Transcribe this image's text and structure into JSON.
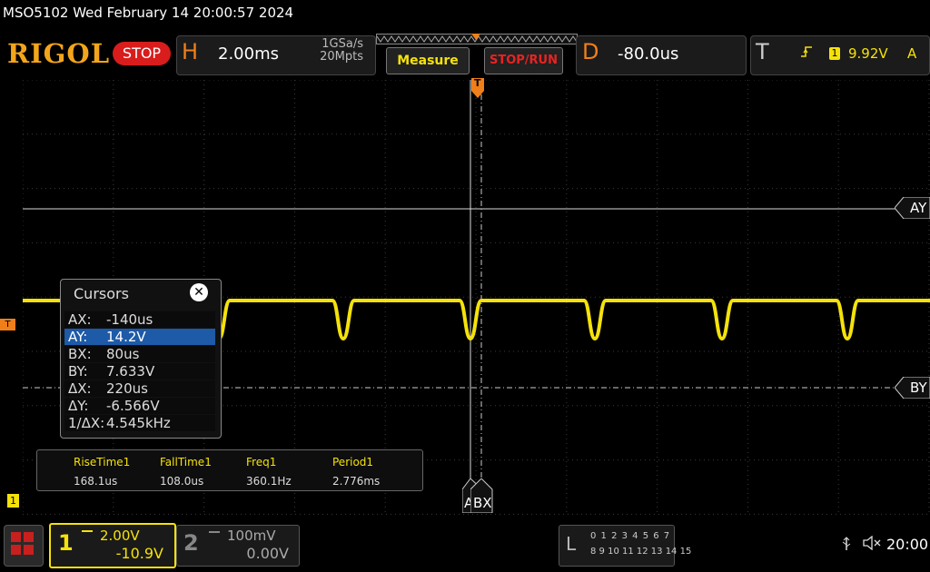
{
  "header": {
    "title_bar": "MSO5102  Wed February 14 20:00:57 2024",
    "logo": "RIGOL",
    "run_state": "STOP"
  },
  "horizontal": {
    "letter": "H",
    "timebase": "2.00ms",
    "sample_rate": "1GSa/s",
    "memory_depth": "20Mpts"
  },
  "buttons": {
    "measure": "Measure",
    "stop_run": "STOP/RUN"
  },
  "delay": {
    "letter": "D",
    "value": "-80.0us"
  },
  "trigger": {
    "letter": "T",
    "edge_icon": "rising-edge-icon",
    "source": "1",
    "level": "9.92V",
    "mode": "A"
  },
  "markers": {
    "trigger_top": "T",
    "trigger_level": "T",
    "ch1": "1",
    "ay": "AY",
    "by": "BY",
    "ax": "A",
    "bx": "BX"
  },
  "cursors": {
    "title": "Cursors",
    "close_icon": "close-icon",
    "rows": [
      {
        "label": "AX:",
        "value": "-140us",
        "selected": false
      },
      {
        "label": "AY:",
        "value": "14.2V",
        "selected": true
      },
      {
        "label": "BX:",
        "value": "80us",
        "selected": false
      },
      {
        "label": "BY:",
        "value": "7.633V",
        "selected": false
      },
      {
        "label": "ΔX:",
        "value": "220us",
        "selected": false
      },
      {
        "label": "ΔY:",
        "value": "-6.566V",
        "selected": false
      },
      {
        "label": "1/ΔX:",
        "value": "4.545kHz",
        "selected": false
      }
    ]
  },
  "measurements": [
    {
      "name": "RiseTime1",
      "value": "168.1us"
    },
    {
      "name": "FallTime1",
      "value": "108.0us"
    },
    {
      "name": "Freq1",
      "value": "360.1Hz"
    },
    {
      "name": "Period1",
      "value": "2.776ms"
    }
  ],
  "channels": {
    "ch1": {
      "number": "1",
      "scale": "2.00V",
      "offset": "-10.9V",
      "color": "#f5e20a"
    },
    "ch2": {
      "number": "2",
      "scale": "100mV",
      "offset": "0.00V",
      "color": "#888888"
    }
  },
  "logic": {
    "letter": "L",
    "row1": "0 1 2 3  4 5 6 7",
    "row2": "8 9 10 11 12 13 14 15"
  },
  "status": {
    "usb_icon": "usb-icon",
    "speaker_icon": "speaker-muted-icon",
    "time": "20:00"
  },
  "colors": {
    "trace": "#f5e20a",
    "accent": "#f07f1a",
    "stop": "#d91c1c"
  }
}
